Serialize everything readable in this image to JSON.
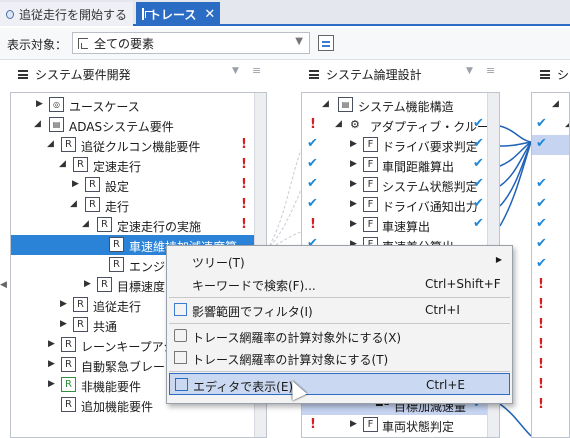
{
  "tabs": [
    {
      "label": "追従走行を開始する"
    },
    {
      "label": "トレース",
      "close": "✕"
    }
  ],
  "toolbar": {
    "display_label": "表示対象：",
    "combo_value": "全ての要素"
  },
  "panels": [
    {
      "title": "システム要件開発"
    },
    {
      "title": "システム論理設計"
    },
    {
      "title": "シ"
    }
  ],
  "pane1_rows": [
    {
      "label": "ユースケース",
      "icon": "use-case-icon"
    },
    {
      "label": "ADASシステム要件",
      "icon": "package-icon"
    },
    {
      "label": "追従クルコン機能要件",
      "icon": "R",
      "bang": "!"
    },
    {
      "label": "定速走行",
      "icon": "R",
      "bang": "!"
    },
    {
      "label": "設定",
      "icon": "R",
      "bang": "!"
    },
    {
      "label": "走行",
      "icon": "R",
      "bang": "!"
    },
    {
      "label": "定速走行の実施",
      "icon": "R",
      "bang": "!"
    },
    {
      "label": "車速維持加減速度算",
      "icon": "R"
    },
    {
      "label": "エンジン",
      "icon": "R"
    },
    {
      "label": "目標速度の",
      "icon": "R"
    },
    {
      "label": "追従走行",
      "icon": "R"
    },
    {
      "label": "共通",
      "icon": "R"
    },
    {
      "label": "レーンキープアシス",
      "icon": "R"
    },
    {
      "label": "自動緊急ブレーキ",
      "icon": "R"
    },
    {
      "label": "非機能要件",
      "icon": "R"
    },
    {
      "label": "追加機能要件",
      "icon": "R"
    }
  ],
  "pane2_rows": [
    {
      "label": "システム機能構造"
    },
    {
      "label": "アダプティブ・クルーズ"
    },
    {
      "label": "ドライバ要求判定"
    },
    {
      "label": "車間距離算出"
    },
    {
      "label": "システム状態判定"
    },
    {
      "label": "ドライバ通知出力"
    },
    {
      "label": "車速算出"
    },
    {
      "label": "車速差分算出"
    },
    {
      "label": "目標加減速量"
    },
    {
      "label": "車両状態判定"
    }
  ],
  "context_menu": {
    "items": [
      {
        "label": "ツリー(T)",
        "shortcut": ""
      },
      {
        "label": "キーワードで検索(F)...",
        "shortcut": "Ctrl+Shift+F"
      },
      {
        "label": "影響範囲でフィルタ(I)",
        "shortcut": "Ctrl+I"
      },
      {
        "label": "トレース網羅率の計算対象外にする(X)",
        "shortcut": ""
      },
      {
        "label": "トレース網羅率の計算対象にする(T)",
        "shortcut": ""
      },
      {
        "label": "エディタで表示(E)",
        "shortcut": "Ctrl+E"
      }
    ]
  },
  "marks": {
    "bang": "!",
    "check": "✔",
    "tri_right": "▶",
    "tri_down": "◢"
  },
  "colors": {
    "accent": "#2b6cc4",
    "selection": "#2b83d8",
    "error": "#d21f1f",
    "check": "#1f88d6"
  }
}
